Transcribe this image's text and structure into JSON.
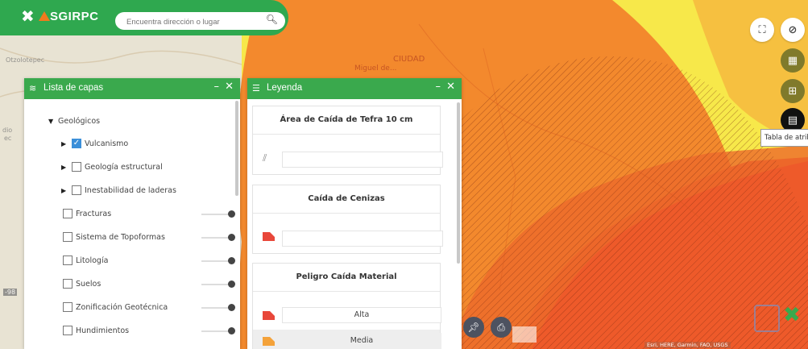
{
  "app": {
    "logo_text": "SGIRPC",
    "logo_icon": "sgirpc-cross-icon",
    "search_placeholder": "Encuentra dirección o lugar",
    "search_icon": "search-icon"
  },
  "map_labels": {
    "town_1": "Otzolotepec",
    "partial_1": "dio",
    "partial_2": "ec",
    "label_ciudad": "CIUDAD",
    "label_miguel": "Miguel de...",
    "partial_top": "de",
    "left_num": "-98"
  },
  "right_controls": {
    "fullscreen": "fullscreen-icon",
    "visibility": "eye-off-icon",
    "basemaps": "grid-icon",
    "add_data": "plus-box-icon",
    "attribute_table": "table-icon",
    "tooltip": "Tabla de atributos"
  },
  "layers_panel": {
    "title": "Lista de capas",
    "group": "Geológicos",
    "items": [
      {
        "label": "Vulcanismo",
        "expandable": true,
        "checked": true
      },
      {
        "label": "Geología estructural",
        "expandable": true,
        "checked": false
      },
      {
        "label": "Inestabilidad de laderas",
        "expandable": true,
        "checked": false
      },
      {
        "label": "Fracturas",
        "expandable": false,
        "checked": false
      },
      {
        "label": "Sistema de Topoformas",
        "expandable": false,
        "checked": false
      },
      {
        "label": "Litología",
        "expandable": false,
        "checked": false
      },
      {
        "label": "Suelos",
        "expandable": false,
        "checked": false
      },
      {
        "label": "Zonificación Geotécnica",
        "expandable": false,
        "checked": false
      },
      {
        "label": "Hundimientos",
        "expandable": false,
        "checked": false
      }
    ]
  },
  "legend_panel": {
    "title": "Leyenda",
    "sections": [
      {
        "title": "Área de Caída de Tefra 10 cm",
        "entries": [
          {
            "swatch": "hatch",
            "label": ""
          }
        ]
      },
      {
        "title": "Caída de Cenizas",
        "entries": [
          {
            "swatch": "red",
            "label": ""
          }
        ]
      },
      {
        "title": "Peligro Caída Material",
        "entries": [
          {
            "swatch": "red",
            "label": "Alta"
          },
          {
            "swatch": "orange",
            "label": "Media"
          }
        ]
      }
    ]
  },
  "map_tools": {
    "pin": "pin-icon",
    "print": "printer-icon"
  },
  "attribution": "Esri, HERE, Garmin, FAO, USGS",
  "colors": {
    "brand_green": "#3aa94d",
    "hazard_yellow": "#f7e84a",
    "hazard_orange": "#f3892d",
    "hazard_red": "#ee5a2a",
    "checkbox_blue": "#3b8fd9"
  }
}
